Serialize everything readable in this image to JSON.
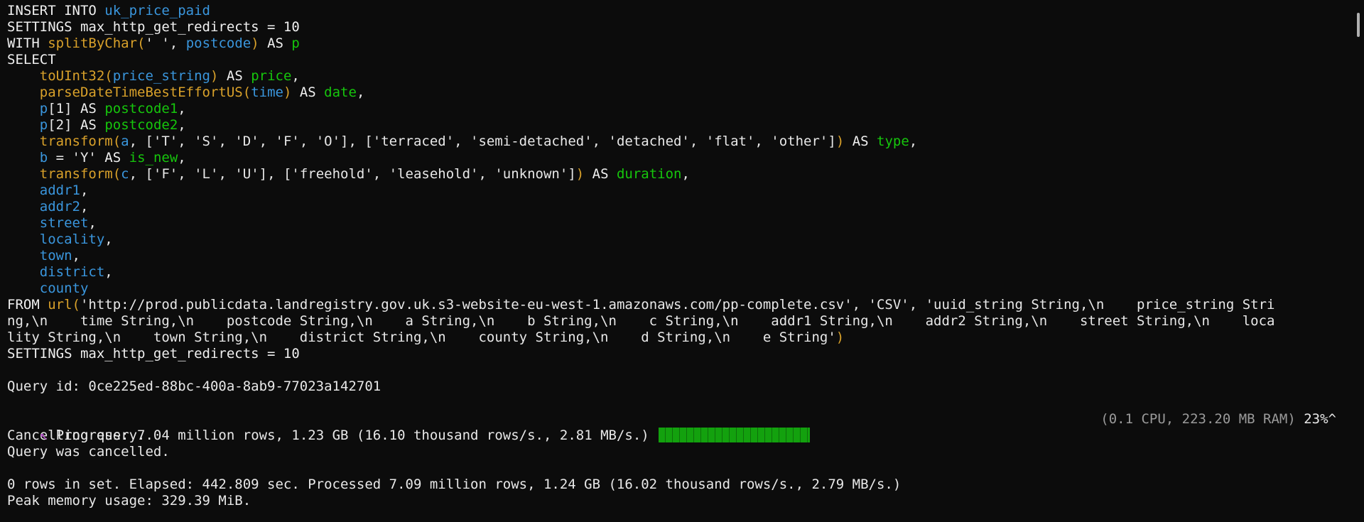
{
  "terminal": {
    "colors": {
      "background": "#0c0c0c",
      "text": "#e8e8e8",
      "keyword": "#f0f0f0",
      "function": "#d9a12a",
      "identifier": "#3a96dd",
      "alias": "#16c60c",
      "dim": "#9a9a9a",
      "spinner": "#b148c6",
      "progress_fill": "#13a10e"
    },
    "lines": [
      [
        [
          "kw",
          "INSERT INTO "
        ],
        [
          "id",
          "uk_price_paid"
        ]
      ],
      [
        [
          "kw",
          "SETTINGS max_http_get_redirects = 10"
        ]
      ],
      [
        [
          "kw",
          "WITH "
        ],
        [
          "fn",
          "splitByChar("
        ],
        [
          "str",
          "' ', "
        ],
        [
          "id",
          "postcode"
        ],
        [
          "fn",
          ")"
        ],
        [
          "kw",
          " AS "
        ],
        [
          "alias",
          "p"
        ]
      ],
      [
        [
          "kw",
          "SELECT"
        ]
      ],
      [
        [
          "text",
          "    "
        ],
        [
          "fn",
          "toUInt32("
        ],
        [
          "id",
          "price_string"
        ],
        [
          "fn",
          ")"
        ],
        [
          "kw",
          " AS "
        ],
        [
          "alias",
          "price"
        ],
        [
          "text",
          ","
        ]
      ],
      [
        [
          "text",
          "    "
        ],
        [
          "fn",
          "parseDateTimeBestEffortUS("
        ],
        [
          "id",
          "time"
        ],
        [
          "fn",
          ")"
        ],
        [
          "kw",
          " AS "
        ],
        [
          "alias",
          "date"
        ],
        [
          "text",
          ","
        ]
      ],
      [
        [
          "text",
          "    "
        ],
        [
          "id",
          "p"
        ],
        [
          "text",
          "[1]"
        ],
        [
          "kw",
          " AS "
        ],
        [
          "alias",
          "postcode1"
        ],
        [
          "text",
          ","
        ]
      ],
      [
        [
          "text",
          "    "
        ],
        [
          "id",
          "p"
        ],
        [
          "text",
          "[2]"
        ],
        [
          "kw",
          " AS "
        ],
        [
          "alias",
          "postcode2"
        ],
        [
          "text",
          ","
        ]
      ],
      [
        [
          "text",
          "    "
        ],
        [
          "fn",
          "transform("
        ],
        [
          "id",
          "a"
        ],
        [
          "text",
          ", ['T', 'S', 'D', 'F', 'O'], ['terraced', 'semi-detached', 'detached', 'flat', 'other']"
        ],
        [
          "fn",
          ")"
        ],
        [
          "kw",
          " AS "
        ],
        [
          "alias",
          "type"
        ],
        [
          "text",
          ","
        ]
      ],
      [
        [
          "text",
          "    "
        ],
        [
          "id",
          "b"
        ],
        [
          "text",
          " = 'Y'"
        ],
        [
          "kw",
          " AS "
        ],
        [
          "alias",
          "is_new"
        ],
        [
          "text",
          ","
        ]
      ],
      [
        [
          "text",
          "    "
        ],
        [
          "fn",
          "transform("
        ],
        [
          "id",
          "c"
        ],
        [
          "text",
          ", ['F', 'L', 'U'], ['freehold', 'leasehold', 'unknown']"
        ],
        [
          "fn",
          ")"
        ],
        [
          "kw",
          " AS "
        ],
        [
          "alias",
          "duration"
        ],
        [
          "text",
          ","
        ]
      ],
      [
        [
          "text",
          "    "
        ],
        [
          "id",
          "addr1"
        ],
        [
          "text",
          ","
        ]
      ],
      [
        [
          "text",
          "    "
        ],
        [
          "id",
          "addr2"
        ],
        [
          "text",
          ","
        ]
      ],
      [
        [
          "text",
          "    "
        ],
        [
          "id",
          "street"
        ],
        [
          "text",
          ","
        ]
      ],
      [
        [
          "text",
          "    "
        ],
        [
          "id",
          "locality"
        ],
        [
          "text",
          ","
        ]
      ],
      [
        [
          "text",
          "    "
        ],
        [
          "id",
          "town"
        ],
        [
          "text",
          ","
        ]
      ],
      [
        [
          "text",
          "    "
        ],
        [
          "id",
          "district"
        ],
        [
          "text",
          ","
        ]
      ],
      [
        [
          "text",
          "    "
        ],
        [
          "id",
          "county"
        ]
      ],
      [
        [
          "kw",
          "FROM "
        ],
        [
          "fn",
          "url("
        ],
        [
          "str",
          "'http://prod.publicdata.landregistry.gov.uk.s3-website-eu-west-1.amazonaws.com/pp-complete.csv', 'CSV', 'uuid_string String,\\n    price_string Stri"
        ]
      ],
      [
        [
          "str",
          "ng,\\n    time String,\\n    postcode String,\\n    a String,\\n    b String,\\n    c String,\\n    addr1 String,\\n    addr2 String,\\n    street String,\\n    loca"
        ]
      ],
      [
        [
          "str",
          "lity String,\\n    town String,\\n    district String,\\n    county String,\\n    d String,\\n    e String'"
        ],
        [
          "fn",
          ")"
        ]
      ],
      [
        [
          "kw",
          "SETTINGS max_http_get_redirects = 10"
        ]
      ],
      [
        [
          "text",
          ""
        ]
      ],
      [
        [
          "text",
          "Query id: 0ce225ed-88bc-400a-8ab9-77023a142701"
        ]
      ],
      [
        [
          "text",
          ""
        ]
      ]
    ],
    "progress": {
      "spinner": "↖",
      "text": " Progress: 7.04 million rows, 1.23 GB (16.10 thousand rows/s., 2.81 MB/s.) ",
      "fraction": 0.23,
      "resources": "(0.1 CPU, 223.20 MB RAM)",
      "percent": " 23%^"
    },
    "footer_lines": [
      "Cancelling query.",
      "Query was cancelled.",
      "",
      "0 rows in set. Elapsed: 442.809 sec. Processed 7.09 million rows, 1.24 GB (16.02 thousand rows/s., 2.79 MB/s.)",
      "Peak memory usage: 329.39 MiB."
    ]
  }
}
